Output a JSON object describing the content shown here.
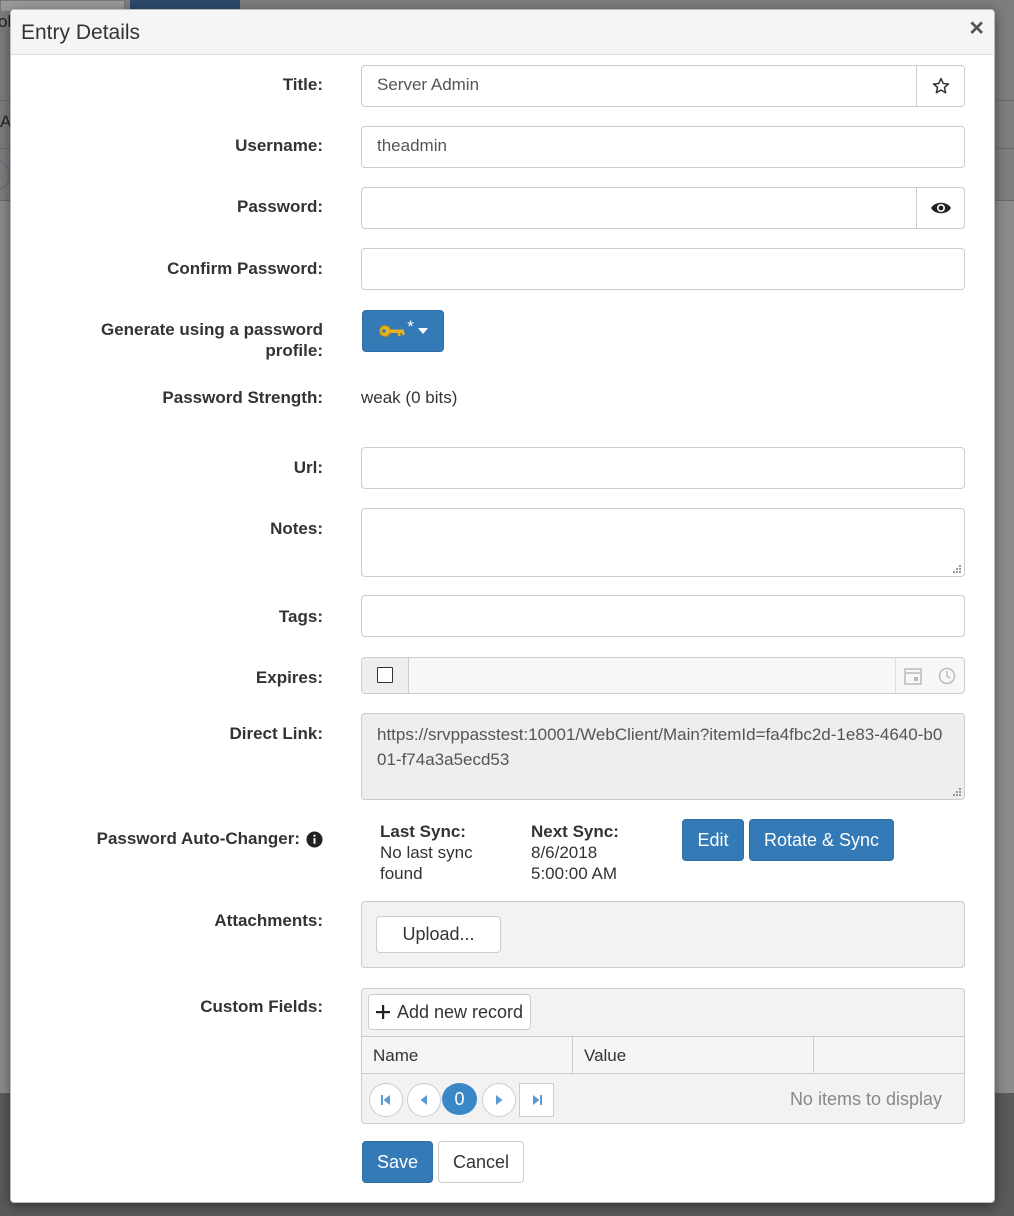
{
  "background": {
    "fragment_top": "ol",
    "fragment_left": "A"
  },
  "modal": {
    "title": "Entry Details",
    "close_symbol": "×"
  },
  "form": {
    "title_label": "Title:",
    "title_value": "Server Admin",
    "username_label": "Username:",
    "username_value": "theadmin",
    "password_label": "Password:",
    "password_value": "",
    "confirm_label": "Confirm Password:",
    "confirm_value": "",
    "generate_label": "Generate using a password profile:",
    "generate_button_suffix": "*",
    "strength_label": "Password Strength:",
    "strength_value": "weak (0 bits)",
    "url_label": "Url:",
    "url_value": "",
    "notes_label": "Notes:",
    "notes_value": "",
    "tags_label": "Tags:",
    "tags_value": "",
    "expires_label": "Expires:",
    "expires_value": "",
    "direct_link_label": "Direct Link:",
    "direct_link_value": "https://srvppasstest:10001/WebClient/Main?itemId=fa4fbc2d-1e83-4640-b001-f74a3a5ecd53",
    "auto_changer_label": "Password Auto-Changer:",
    "last_sync_label": "Last Sync:",
    "last_sync_value": "No last sync found",
    "next_sync_label": "Next Sync:",
    "next_sync_date": "8/6/2018",
    "next_sync_time": "5:00:00 AM",
    "edit_button": "Edit",
    "rotate_button": "Rotate & Sync",
    "attachments_label": "Attachments:",
    "upload_button": "Upload...",
    "custom_fields_label": "Custom Fields:",
    "add_record_button": "Add new record",
    "columns": [
      "Name",
      "Value"
    ],
    "current_page": "0",
    "no_items": "No items to display"
  },
  "footer": {
    "save_button": "Save",
    "cancel_button": "Cancel"
  },
  "colors": {
    "primary": "#337ab7",
    "key_icon": "#e8b020"
  },
  "icons": [
    "star-icon",
    "eye-icon",
    "key-icon",
    "calendar-icon",
    "clock-icon",
    "info-icon",
    "plus-icon",
    "first-page-icon",
    "prev-page-icon",
    "next-page-icon",
    "last-page-icon"
  ]
}
